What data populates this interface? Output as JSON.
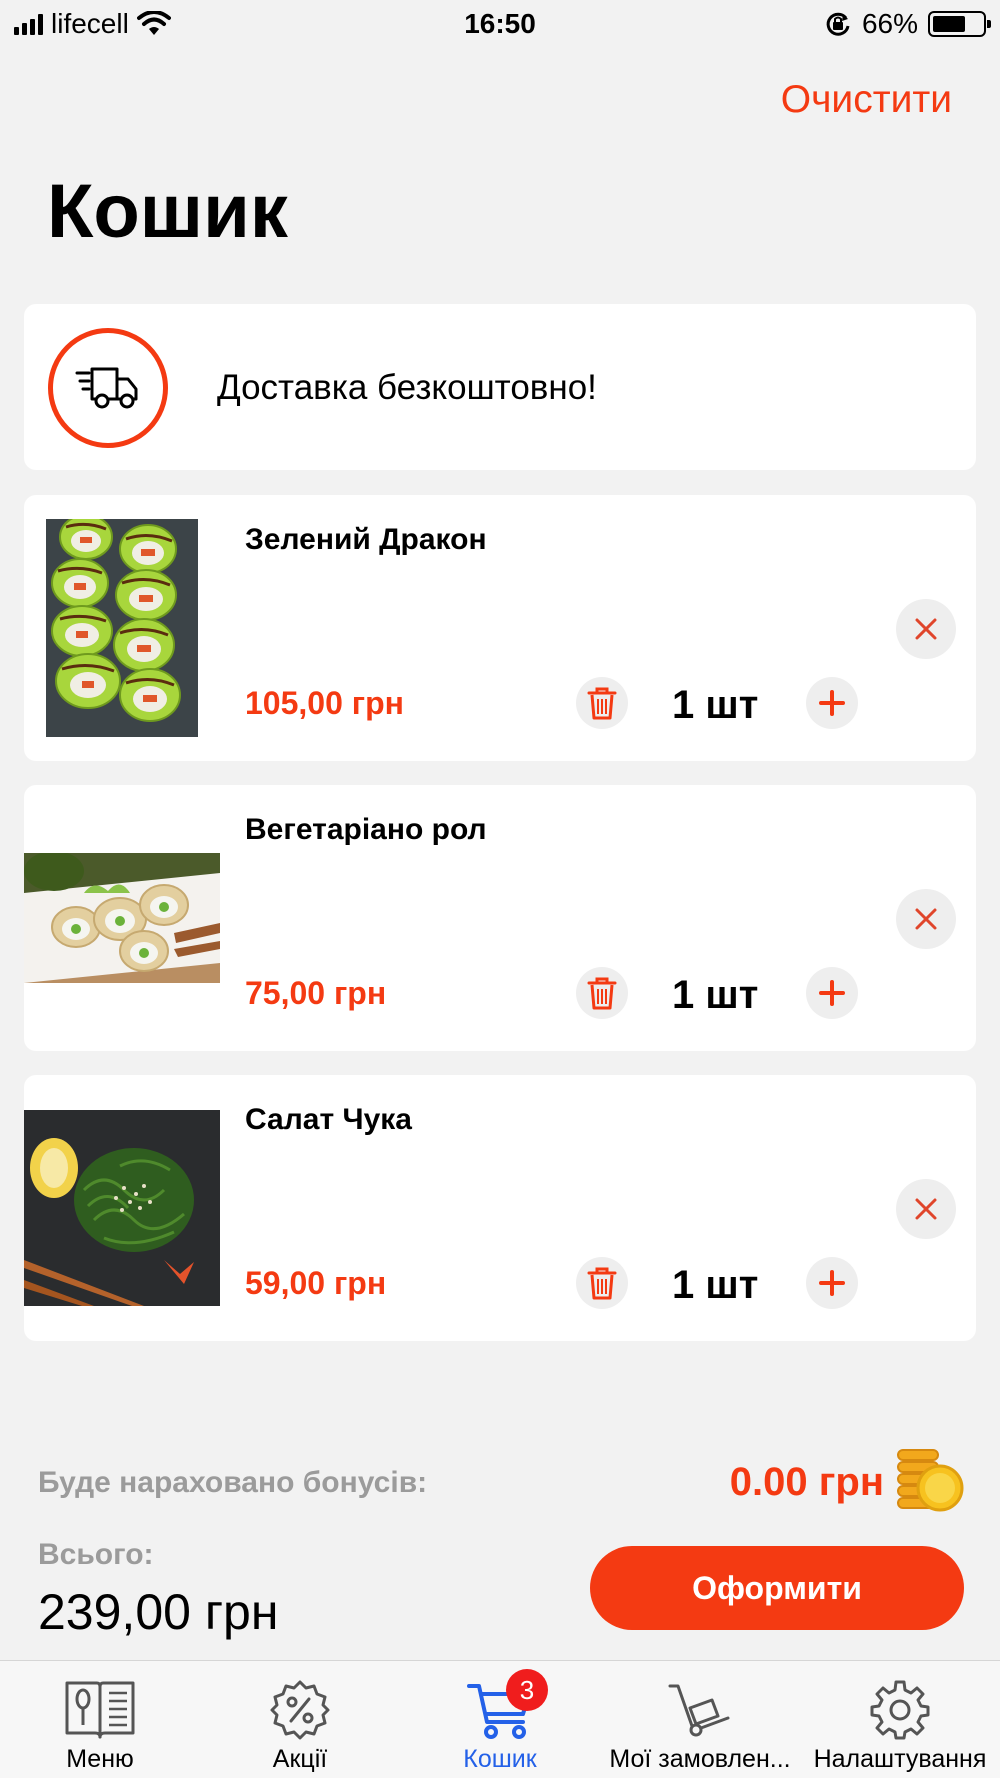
{
  "status_bar": {
    "carrier": "lifecell",
    "time": "16:50",
    "battery": "66%",
    "battery_level": 0.66
  },
  "header": {
    "clear_label": "Очистити",
    "title": "Кошик"
  },
  "delivery": {
    "icon": "delivery-truck-icon",
    "text": "Доставка безкоштовно!"
  },
  "items": [
    {
      "name": "Зелений Дракон",
      "price": "105,00 грн",
      "quantity": "1 шт"
    },
    {
      "name": "Вегетаріано рол",
      "price": "75,00 грн",
      "quantity": "1 шт"
    },
    {
      "name": "Салат Чука",
      "price": "59,00 грн",
      "quantity": "1 шт"
    }
  ],
  "totals": {
    "bonus_label": "Буде нараховано бонусів:",
    "bonus_value": "0.00 грн",
    "total_label": "Всього:",
    "total_value": "239,00 грн",
    "checkout_label": "Оформити"
  },
  "tabbar": {
    "tabs": [
      {
        "label": "Меню",
        "icon": "menu-book-icon"
      },
      {
        "label": "Акції",
        "icon": "discount-badge-icon"
      },
      {
        "label": "Кошик",
        "icon": "cart-icon",
        "badge": "3",
        "active": true
      },
      {
        "label": "Мої замовлен...",
        "icon": "hand-truck-icon"
      },
      {
        "label": "Налаштування",
        "icon": "gear-icon"
      }
    ]
  },
  "colors": {
    "accent": "#f43a12",
    "active_tab": "#2461e8",
    "badge": "#f01d1d",
    "background": "#f2f2f2"
  }
}
